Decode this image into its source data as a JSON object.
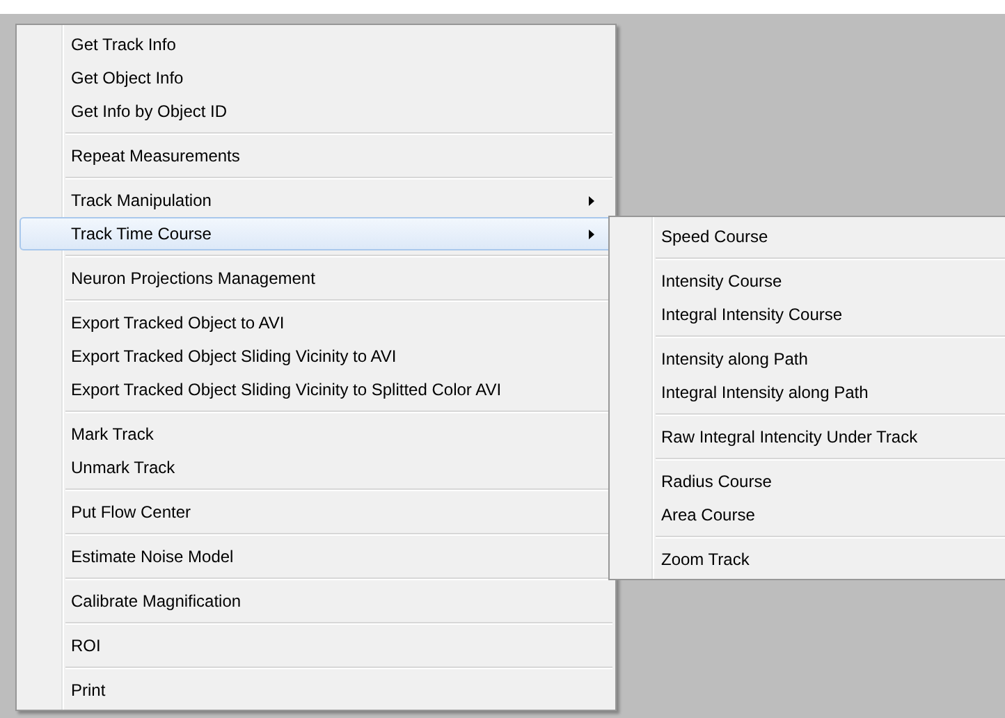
{
  "menu": {
    "groups": [
      {
        "items": [
          {
            "label": "Get Track Info",
            "has_submenu": false,
            "selected": false
          },
          {
            "label": "Get Object Info",
            "has_submenu": false,
            "selected": false
          },
          {
            "label": "Get Info by Object ID",
            "has_submenu": false,
            "selected": false
          }
        ]
      },
      {
        "items": [
          {
            "label": "Repeat Measurements",
            "has_submenu": false,
            "selected": false
          }
        ]
      },
      {
        "items": [
          {
            "label": "Track Manipulation",
            "has_submenu": true,
            "selected": false
          },
          {
            "label": "Track Time Course",
            "has_submenu": true,
            "selected": true
          }
        ]
      },
      {
        "items": [
          {
            "label": "Neuron Projections Management",
            "has_submenu": false,
            "selected": false
          }
        ]
      },
      {
        "items": [
          {
            "label": "Export Tracked Object to AVI",
            "has_submenu": false,
            "selected": false
          },
          {
            "label": "Export Tracked Object Sliding Vicinity to AVI",
            "has_submenu": false,
            "selected": false
          },
          {
            "label": "Export Tracked Object Sliding Vicinity to Splitted Color AVI",
            "has_submenu": false,
            "selected": false
          }
        ]
      },
      {
        "items": [
          {
            "label": "Mark Track",
            "has_submenu": false,
            "selected": false
          },
          {
            "label": "Unmark Track",
            "has_submenu": false,
            "selected": false
          }
        ]
      },
      {
        "items": [
          {
            "label": "Put Flow Center",
            "has_submenu": false,
            "selected": false
          }
        ]
      },
      {
        "items": [
          {
            "label": "Estimate Noise Model",
            "has_submenu": false,
            "selected": false
          }
        ]
      },
      {
        "items": [
          {
            "label": "Calibrate Magnification",
            "has_submenu": false,
            "selected": false
          }
        ]
      },
      {
        "items": [
          {
            "label": "ROI",
            "has_submenu": false,
            "selected": false
          }
        ]
      },
      {
        "items": [
          {
            "label": "Print",
            "has_submenu": false,
            "selected": false
          }
        ]
      }
    ]
  },
  "submenu": {
    "groups": [
      {
        "items": [
          {
            "label": "Speed Course"
          }
        ]
      },
      {
        "items": [
          {
            "label": "Intensity Course"
          },
          {
            "label": "Integral Intensity Course"
          }
        ]
      },
      {
        "items": [
          {
            "label": "Intensity along Path"
          },
          {
            "label": "Integral Intensity along Path"
          }
        ]
      },
      {
        "items": [
          {
            "label": "Raw Integral Intencity Under Track"
          }
        ]
      },
      {
        "items": [
          {
            "label": "Radius Course"
          },
          {
            "label": "Area Course"
          }
        ]
      },
      {
        "items": [
          {
            "label": "Zoom Track"
          }
        ]
      }
    ]
  }
}
